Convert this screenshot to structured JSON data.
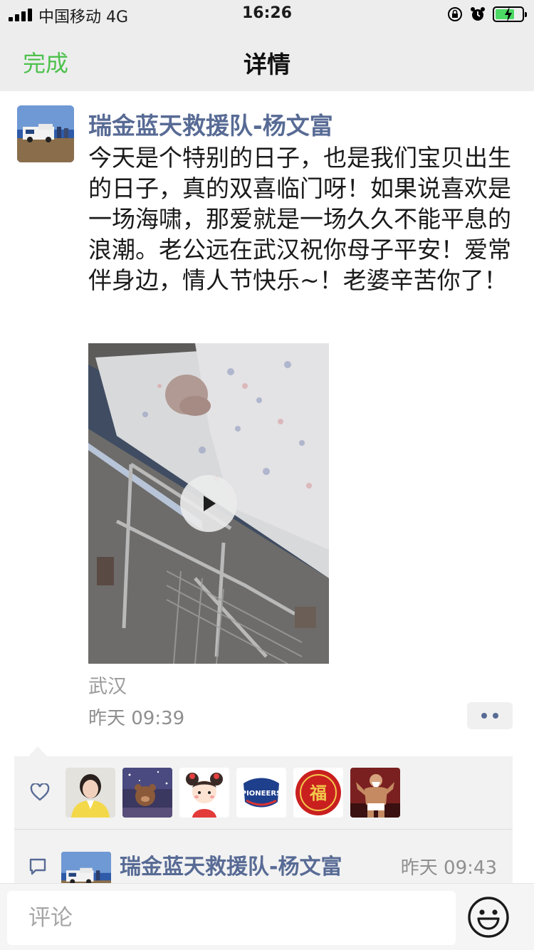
{
  "status": {
    "carrier": "中国移动  4G",
    "time": "16:26",
    "battery_level": 0.72
  },
  "nav": {
    "done_label": "完成",
    "title": "详情"
  },
  "post": {
    "author": "瑞金蓝天救援队-杨文富",
    "content": "今天是个特别的日子，也是我们宝贝出生的日子，真的双喜临门呀！如果说喜欢是一场海啸，那爱就是一场久久不能平息的浪潮。老公远在武汉祝你母子平安！爱常伴身边，情人节快乐~！老婆辛苦你了！",
    "location": "武汉",
    "time": "昨天 09:39"
  },
  "likes": {
    "icon": "heart-outline-icon",
    "avatars": [
      "avatar-woman-yellow-shirt",
      "avatar-bear-night",
      "avatar-cartoon-girl",
      "avatar-pioneers-logo",
      "avatar-red-fu-seal",
      "avatar-muscle-old-man"
    ],
    "badge_text": {
      "pioneers": "PIONEERS",
      "fu": "福"
    }
  },
  "comment": {
    "icon": "comment-bubble-icon",
    "author": "瑞金蓝天救援队-杨文富",
    "time": "昨天 09:43"
  },
  "input": {
    "placeholder": "评论"
  },
  "colors": {
    "accent_green": "#4ec14e",
    "name_blue": "#586b95",
    "panel_bg": "#f2f2f2"
  }
}
